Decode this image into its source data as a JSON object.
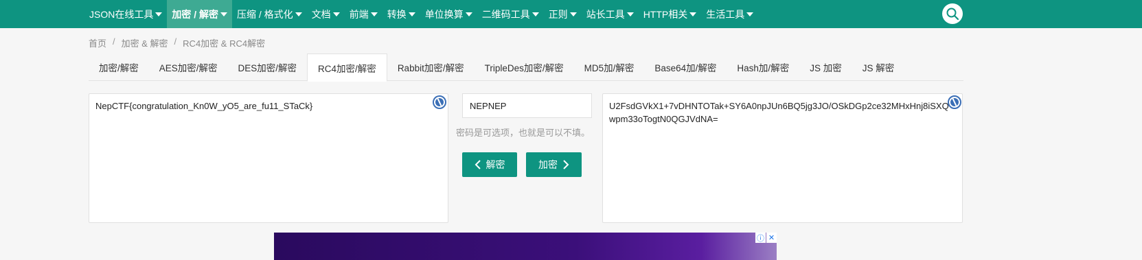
{
  "nav": {
    "items": [
      {
        "label": "JSON在线工具",
        "dropdown": true,
        "active": false
      },
      {
        "label": "加密 / 解密",
        "dropdown": true,
        "active": true
      },
      {
        "label": "压缩 / 格式化",
        "dropdown": true,
        "active": false
      },
      {
        "label": "文档",
        "dropdown": true,
        "active": false
      },
      {
        "label": "前端",
        "dropdown": true,
        "active": false
      },
      {
        "label": "转换",
        "dropdown": true,
        "active": false
      },
      {
        "label": "单位换算",
        "dropdown": true,
        "active": false
      },
      {
        "label": "二维码工具",
        "dropdown": true,
        "active": false
      },
      {
        "label": "正则",
        "dropdown": true,
        "active": false
      },
      {
        "label": "站长工具",
        "dropdown": true,
        "active": false
      },
      {
        "label": "HTTP相关",
        "dropdown": true,
        "active": false
      },
      {
        "label": "生活工具",
        "dropdown": true,
        "active": false
      }
    ],
    "search_icon": "search-icon"
  },
  "breadcrumb": {
    "items": [
      "首页",
      "加密 & 解密",
      "RC4加密 & RC4解密"
    ],
    "separator": "/"
  },
  "tabs": [
    {
      "label": "加密/解密",
      "active": false
    },
    {
      "label": "AES加密/解密",
      "active": false
    },
    {
      "label": "DES加密/解密",
      "active": false
    },
    {
      "label": "RC4加密/解密",
      "active": true
    },
    {
      "label": "Rabbit加密/解密",
      "active": false
    },
    {
      "label": "TripleDes加密/解密",
      "active": false
    },
    {
      "label": "MD5加/解密",
      "active": false
    },
    {
      "label": "Base64加/解密",
      "active": false
    },
    {
      "label": "Hash加/解密",
      "active": false
    },
    {
      "label": "JS 加密",
      "active": false
    },
    {
      "label": "JS 解密",
      "active": false
    }
  ],
  "plaintext": {
    "value": "NepCTF{congratulation_Kn0W_yO5_are_fu11_STaCk}"
  },
  "password": {
    "value": "NEPNEP",
    "hint": "密码是可选项，也就是可以不填。"
  },
  "buttons": {
    "decrypt_label": "解密",
    "encrypt_label": "加密"
  },
  "ciphertext": {
    "value": "U2FsdGVkX1+7vDHNTOTak+SY6A0npJUn6BQ5jg3JO/OSkDGp2ce32MHxHnj8iSXQwpm33oTogtN0QGJVdNA="
  },
  "colors": {
    "brand": "#0e9481",
    "nav_active": "#3eaa93",
    "badge": "#3b6fb6"
  },
  "ad": {
    "info_glyph": "ⓘ",
    "close_glyph": "✕"
  }
}
